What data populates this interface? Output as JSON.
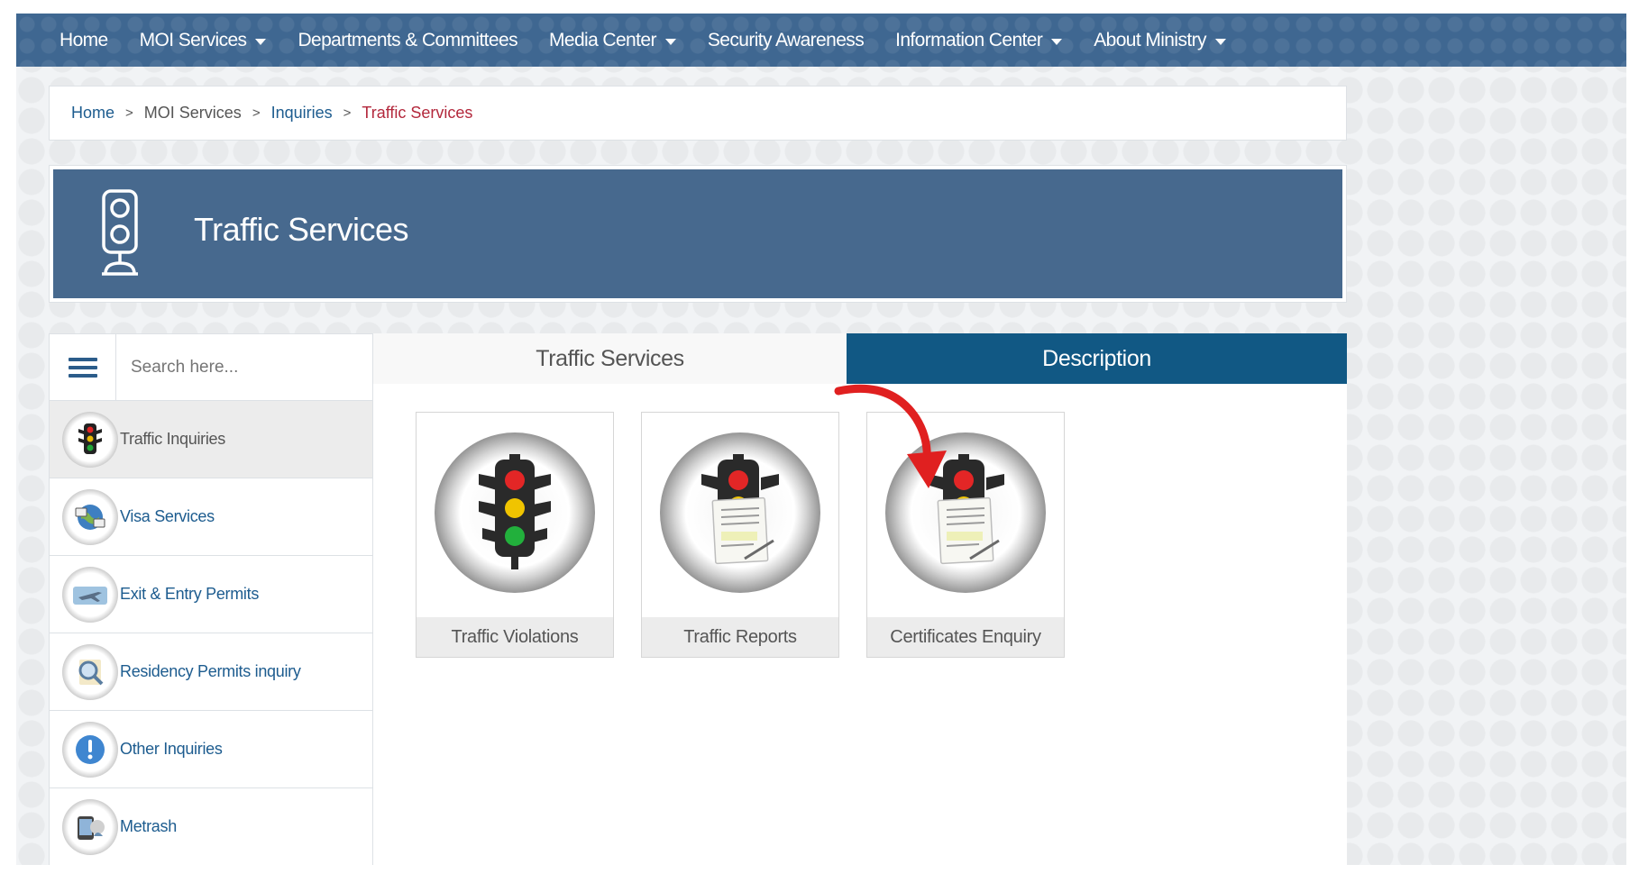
{
  "nav": {
    "items": [
      {
        "label": "Home",
        "has_dropdown": false
      },
      {
        "label": "MOI Services",
        "has_dropdown": true
      },
      {
        "label": "Departments & Committees",
        "has_dropdown": false
      },
      {
        "label": "Media Center",
        "has_dropdown": true
      },
      {
        "label": "Security Awareness",
        "has_dropdown": false
      },
      {
        "label": "Information Center",
        "has_dropdown": true
      },
      {
        "label": "About Ministry",
        "has_dropdown": true
      }
    ]
  },
  "breadcrumb": {
    "home": "Home",
    "sep": ">",
    "level1": "MOI Services",
    "level2": "Inquiries",
    "current": "Traffic Services"
  },
  "banner": {
    "title": "Traffic Services",
    "icon": "traffic-light-outline-icon"
  },
  "sidebar": {
    "search_placeholder": "Search here...",
    "items": [
      {
        "label": "Traffic Inquiries",
        "icon": "traffic-light-icon",
        "active": true
      },
      {
        "label": "Visa Services",
        "icon": "globe-visa-icon",
        "active": false
      },
      {
        "label": "Exit & Entry Permits",
        "icon": "airplane-icon",
        "active": false
      },
      {
        "label": "Residency Permits inquiry",
        "icon": "magnifier-icon",
        "active": false
      },
      {
        "label": "Other Inquiries",
        "icon": "exclamation-icon",
        "active": false
      },
      {
        "label": "Metrash",
        "icon": "metrash-app-icon",
        "active": false
      }
    ]
  },
  "tabs": {
    "services": "Traffic Services",
    "description": "Description"
  },
  "cards": [
    {
      "label": "Traffic Violations",
      "icon": "traffic-light-icon"
    },
    {
      "label": "Traffic Reports",
      "icon": "traffic-light-document-icon"
    },
    {
      "label": "Certificates Enquiry",
      "icon": "traffic-light-certificate-icon"
    }
  ],
  "colors": {
    "nav_bg": "#3f6791",
    "banner_bg": "#47698e",
    "active_tab": "#115884",
    "link": "#1d5c8f",
    "breadcrumb_current": "#b3283c",
    "annotation_arrow": "#e02020"
  }
}
